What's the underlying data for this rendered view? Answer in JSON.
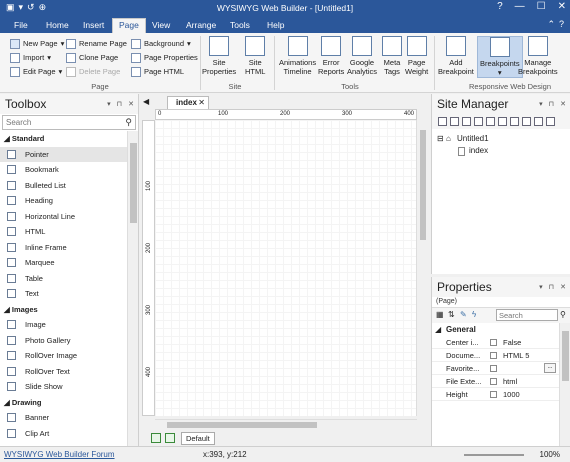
{
  "app": {
    "title": "WYSIWYG Web Builder - [Untitled1]"
  },
  "quick_access": [
    "new-icon",
    "save-icon",
    "undo-icon",
    "preview-icon"
  ],
  "window_controls": {
    "help": "?",
    "minimize": "—",
    "maximize": "☐",
    "close": "✕"
  },
  "menu_tabs": [
    "File",
    "Home",
    "Insert",
    "Page",
    "View",
    "Arrange",
    "Tools",
    "Help"
  ],
  "active_tab": "Page",
  "ribbon": {
    "page_group": {
      "label": "Page",
      "new_page": "New Page",
      "import": "Import",
      "edit_page": "Edit Page",
      "rename_page": "Rename Page",
      "clone_page": "Clone Page",
      "delete_page": "Delete Page",
      "background": "Background",
      "page_properties": "Page Properties",
      "page_html": "Page HTML"
    },
    "site_group": {
      "label": "Site",
      "site_properties_1": "Site",
      "site_properties_2": "Properties",
      "site_html_1": "Site",
      "site_html_2": "HTML"
    },
    "tools_group": {
      "label": "Tools",
      "animations_1": "Animations",
      "animations_2": "Timeline",
      "error_1": "Error",
      "error_2": "Reports",
      "google_1": "Google",
      "google_2": "Analytics",
      "meta_1": "Meta",
      "meta_2": "Tags",
      "weight_1": "Page",
      "weight_2": "Weight"
    },
    "responsive_group": {
      "label": "Responsive Web Design",
      "add_bp_1": "Add",
      "add_bp_2": "Breakpoint",
      "breakpoints": "Breakpoints",
      "manage_1": "Manage",
      "manage_2": "Breakpoints"
    }
  },
  "toolbox": {
    "title": "Toolbox",
    "search_placeholder": "Search",
    "categories": [
      {
        "name": "Standard",
        "items": [
          "Pointer",
          "Bookmark",
          "Bulleted List",
          "Heading",
          "Horizontal Line",
          "HTML",
          "Inline Frame",
          "Marquee",
          "Table",
          "Text"
        ]
      },
      {
        "name": "Images",
        "items": [
          "Image",
          "Photo Gallery",
          "RollOver Image",
          "RollOver Text",
          "Slide Show"
        ]
      },
      {
        "name": "Drawing",
        "items": [
          "Banner",
          "Clip Art"
        ]
      }
    ],
    "selected_item": "Pointer"
  },
  "editor": {
    "doc_tab": "index",
    "ruler_h": [
      "0",
      "100",
      "200",
      "300",
      "400"
    ],
    "ruler_v": [
      "100",
      "200",
      "300",
      "400"
    ],
    "breakpoint_label": "Default"
  },
  "site_manager": {
    "title": "Site Manager",
    "root": "Untitled1",
    "pages": [
      "index"
    ]
  },
  "properties": {
    "title": "Properties",
    "object": "(Page)",
    "search_placeholder": "Search",
    "group": "General",
    "rows": [
      {
        "key": "Center i...",
        "value": "False",
        "dots": false
      },
      {
        "key": "Docume...",
        "value": "HTML 5",
        "dots": false
      },
      {
        "key": "Favorite...",
        "value": "",
        "dots": true
      },
      {
        "key": "File Exte...",
        "value": "html",
        "dots": false
      },
      {
        "key": "Height",
        "value": "1000",
        "dots": false
      }
    ]
  },
  "status": {
    "forum_link": "WYSIWYG Web Builder Forum",
    "coords": "x:393, y:212",
    "zoom": "100%"
  }
}
